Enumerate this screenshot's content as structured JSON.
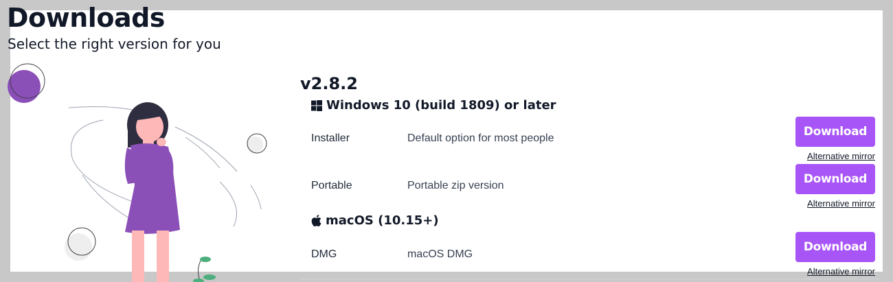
{
  "page": {
    "title": "Downloads",
    "subtitle": "Select the right version for you"
  },
  "release": {
    "version": "v2.8.2",
    "sections": [
      {
        "os_label": "Windows 10 (build 1809) or later",
        "os_icon": "windows-icon",
        "rows": [
          {
            "name": "Installer",
            "description": "Default option for most people",
            "button": "Download",
            "mirror": "Alternative mirror"
          },
          {
            "name": "Portable",
            "description": "Portable zip version",
            "button": "Download",
            "mirror": "Alternative mirror"
          }
        ]
      },
      {
        "os_label": "macOS (10.15+)",
        "os_icon": "apple-icon",
        "rows": [
          {
            "name": "DMG",
            "description": "macOS DMG",
            "button": "Download",
            "mirror": "Alternative mirror"
          }
        ]
      }
    ]
  },
  "colors": {
    "accent": "#a855f7",
    "illustration_purple": "#8b4fb8",
    "background_frame": "#c8c8c8"
  }
}
